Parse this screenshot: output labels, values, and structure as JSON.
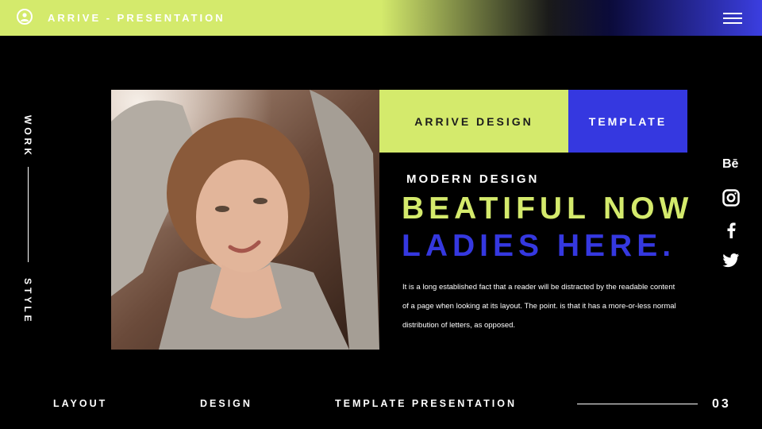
{
  "header": {
    "title": "ARRIVE - PRESENTATION",
    "profile_icon": "user-circle-icon",
    "menu_icon": "hamburger-menu-icon",
    "colors": {
      "green": "#d4ea6c",
      "blue": "#3538e0"
    }
  },
  "sidebar": {
    "top_word": "WORK",
    "bottom_word": "STYLE"
  },
  "hero": {
    "tag_left": "ARRIVE DESIGN",
    "tag_right": "TEMPLATE",
    "subheading": "MODERN DESIGN",
    "headline_line1": "BEATIFUL NOW",
    "headline_line2": "LADIES HERE.",
    "body": "It is a long established fact that a reader will be distracted by the readable content of a page when looking at its layout. The point. is that it has a more-or-less normal distribution of letters, as opposed."
  },
  "social": {
    "behance_label": "Bē",
    "icons": [
      "behance-icon",
      "instagram-icon",
      "facebook-icon",
      "twitter-icon"
    ]
  },
  "footer": {
    "item1": "LAYOUT",
    "item2": "DESIGN",
    "item3": "TEMPLATE PRESENTATION",
    "page_number": "03"
  }
}
